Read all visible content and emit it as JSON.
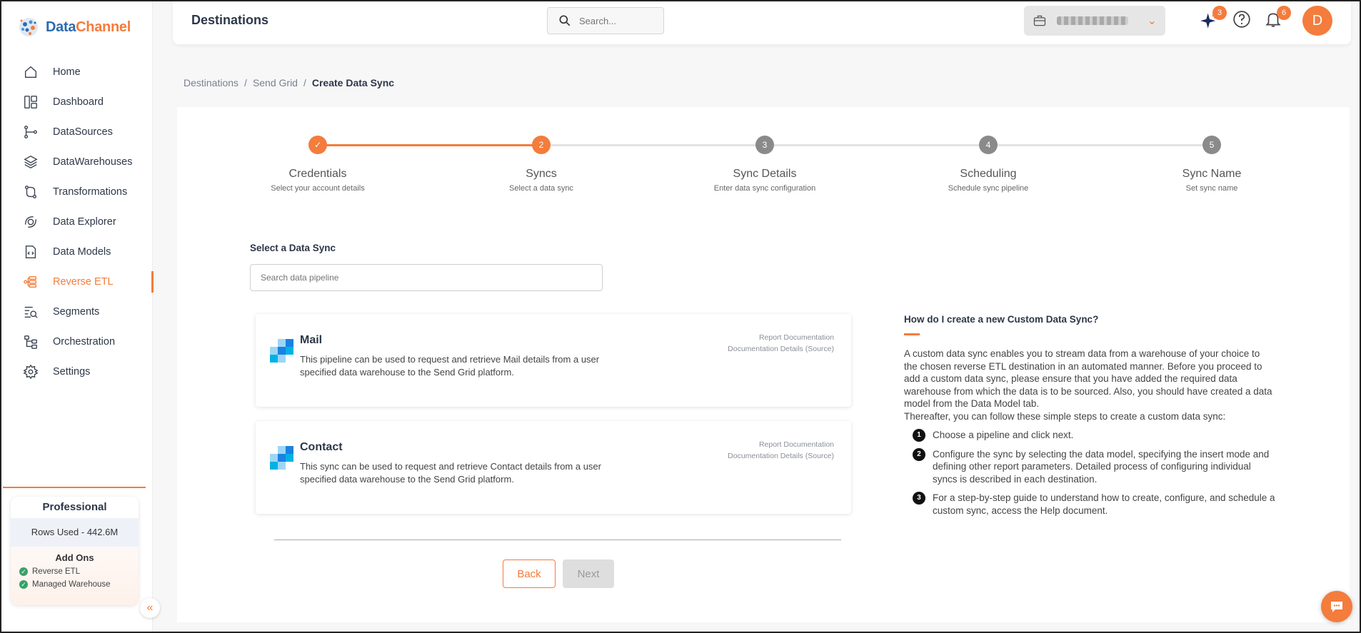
{
  "brand": {
    "name_part1": "Data",
    "name_part2": "Channel"
  },
  "colors": {
    "accent": "#f47c3c",
    "active_step": "#f47c3c",
    "pending_step": "#8a8a8a"
  },
  "sidebar": {
    "items": [
      {
        "label": "Home",
        "icon": "home-icon"
      },
      {
        "label": "Dashboard",
        "icon": "dashboard-icon"
      },
      {
        "label": "DataSources",
        "icon": "datasources-icon"
      },
      {
        "label": "DataWarehouses",
        "icon": "layers-icon"
      },
      {
        "label": "Transformations",
        "icon": "transformations-icon"
      },
      {
        "label": "Data Explorer",
        "icon": "explorer-icon"
      },
      {
        "label": "Data Models",
        "icon": "data-models-icon"
      },
      {
        "label": "Reverse ETL",
        "icon": "reverse-etl-icon",
        "active": true
      },
      {
        "label": "Segments",
        "icon": "segments-icon"
      },
      {
        "label": "Orchestration",
        "icon": "orchestration-icon"
      },
      {
        "label": "Settings",
        "icon": "gear-icon"
      }
    ],
    "plan": {
      "title": "Professional",
      "rows_used": "Rows Used - 442.6M",
      "addons_title": "Add Ons",
      "addons": [
        "Reverse ETL",
        "Managed Warehouse"
      ]
    }
  },
  "header": {
    "title": "Destinations",
    "search_placeholder": "Search...",
    "ai_badge": "3",
    "notifications_badge": "6",
    "avatar_initial": "D"
  },
  "breadcrumb": {
    "items": [
      "Destinations",
      "Send Grid"
    ],
    "current": "Create Data Sync",
    "separator": "/"
  },
  "stepper": {
    "steps": [
      {
        "label": "Credentials",
        "sub": "Select your account details",
        "number": "",
        "state": "done"
      },
      {
        "label": "Syncs",
        "sub": "Select a data sync",
        "number": "2",
        "state": "active"
      },
      {
        "label": "Sync Details",
        "sub": "Enter data sync configuration",
        "number": "3",
        "state": "pending"
      },
      {
        "label": "Scheduling",
        "sub": "Schedule sync pipeline",
        "number": "4",
        "state": "pending"
      },
      {
        "label": "Sync Name",
        "sub": "Set sync name",
        "number": "5",
        "state": "pending"
      }
    ]
  },
  "main": {
    "select_label": "Select a Data Sync",
    "pipeline_search_placeholder": "Search data pipeline",
    "syncs": [
      {
        "title": "Mail",
        "description": "This pipeline can be used to request and retrieve Mail details from a user specified data warehouse to the Send Grid platform.",
        "link1": "Report Documentation",
        "link2": "Documentation Details (Source)"
      },
      {
        "title": "Contact",
        "description": "This sync can be used to request and retrieve Contact details from a user specified data warehouse to the Send Grid platform.",
        "link1": "Report Documentation",
        "link2": "Documentation Details (Source)"
      }
    ],
    "back_label": "Back",
    "next_label": "Next"
  },
  "help": {
    "title": "How do I create a new Custom Data Sync?",
    "body": "A custom data sync enables you to stream data from a warehouse of your choice to the chosen reverse ETL destination in an automated manner. Before you proceed to add a custom data sync, please ensure that you have added the required data warehouse from which the data is to be sourced. Also, you should have created a data model from the Data Model tab.",
    "body2": "Thereafter, you can follow these simple steps to create a custom data sync:",
    "steps": [
      {
        "num": "1",
        "text": "Choose a pipeline and click next."
      },
      {
        "num": "2",
        "text": "Configure the sync by selecting the data model, specifying the insert mode and defining other report parameters. Detailed process of configuring individual syncs is described in each destination."
      },
      {
        "num": "3",
        "text": "For a step-by-step guide to understand how to create, configure, and schedule a custom sync, access the Help document."
      }
    ]
  }
}
